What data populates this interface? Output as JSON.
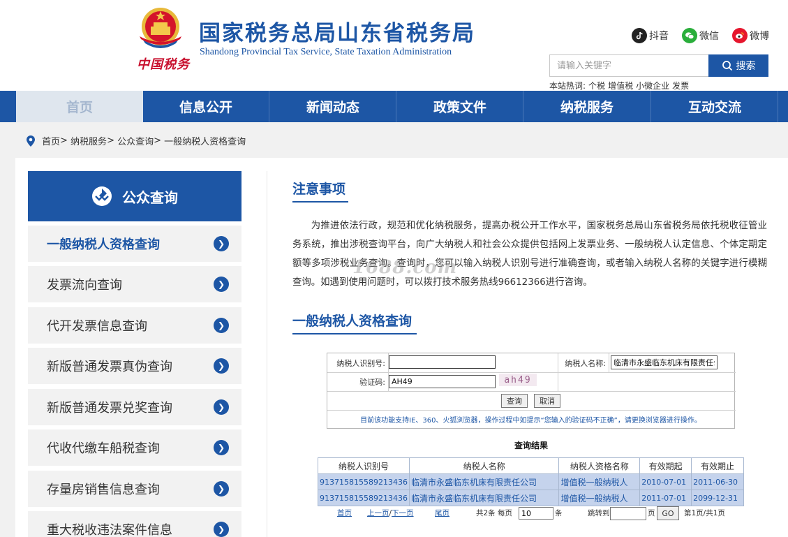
{
  "header": {
    "title": "国家税务总局山东省税务局",
    "subtitle": "Shandong Provincial Tax Service, State Taxation Administration",
    "brand_mark": "中国税务",
    "social": [
      {
        "label": "抖音",
        "icon": "tiktok-icon",
        "color": "#222222"
      },
      {
        "label": "微信",
        "icon": "wechat-icon",
        "color": "#2aae3b"
      },
      {
        "label": "微博",
        "icon": "weibo-icon",
        "color": "#e6162d"
      }
    ],
    "search_placeholder": "请输入关键字",
    "search_button": "搜索",
    "hotwords_label": "本站热词:",
    "hotwords": [
      "个税",
      "增值税",
      "小微企业",
      "发票"
    ]
  },
  "nav": [
    "首页",
    "信息公开",
    "新闻动态",
    "政策文件",
    "纳税服务",
    "互动交流"
  ],
  "breadcrumb": [
    "首页",
    "纳税服务",
    "公众查询",
    "一般纳税人资格查询"
  ],
  "sidebar": {
    "title": "公众查询",
    "items": [
      "一般纳税人资格查询",
      "发票流向查询",
      "代开发票信息查询",
      "新版普通发票真伪查询",
      "新版普通发票兑奖查询",
      "代收代缴车船税查询",
      "存量房销售信息查询",
      "重大税收违法案件信息"
    ]
  },
  "notice": {
    "title": "注意事项",
    "text": "为推进依法行政，规范和优化纳税服务，提高办税公开工作水平，国家税务总局山东省税务局依托税收征管业务系统，推出涉税查询平台，向广大纳税人和社会公众提供包括网上发票业务、一般纳税人认定信息、个体定期定额等多项涉税业务查询。查询时，您可以输入纳税人识别号进行准确查询，或者输入纳税人名称的关键字进行模糊查询。如遇到使用问题时，可以拨打技术服务热线96612366进行咨询。",
    "watermark": "1688.com"
  },
  "query": {
    "title": "一般纳税人资格查询",
    "taxpayer_id_label": "纳税人识别号:",
    "taxpayer_id_value": "",
    "taxpayer_name_label": "纳税人名称:",
    "taxpayer_name_value": "临清市永盛临东机床有限责任公司",
    "captcha_label": "验证码:",
    "captcha_value": "AH49",
    "captcha_image_text": "ah49",
    "submit": "查询",
    "cancel": "取消",
    "note": "目前该功能支持IE、360、火狐浏览器，操作过程中如提示“您输入的验证码不正确”，请更换浏览器进行操作。"
  },
  "results": {
    "title": "查询结果",
    "columns": [
      "纳税人识别号",
      "纳税人名称",
      "纳税人资格名称",
      "有效期起",
      "有效期止"
    ],
    "rows": [
      [
        "913715815589213436",
        "临清市永盛临东机床有限责任公司",
        "增值税一般纳税人",
        "2010-07-01",
        "2011-06-30"
      ],
      [
        "913715815589213436",
        "临清市永盛临东机床有限责任公司",
        "增值税一般纳税人",
        "2011-07-01",
        "2099-12-31"
      ]
    ]
  },
  "pager": {
    "first": "首页",
    "prev": "上一页",
    "sep": "/",
    "next": "下一页",
    "last": "尾页",
    "total": "共2条",
    "per_page_label": "每页",
    "per_page_value": "10",
    "per_page_unit": "条",
    "jump_label": "跳转到",
    "jump_value": "",
    "jump_unit": "页",
    "go": "GO",
    "page_info": "第1页/共1页"
  },
  "colors": {
    "brand_blue": "#1d56a5",
    "row_bg": "#c5d3ec",
    "emblem_red": "#c8102e"
  }
}
